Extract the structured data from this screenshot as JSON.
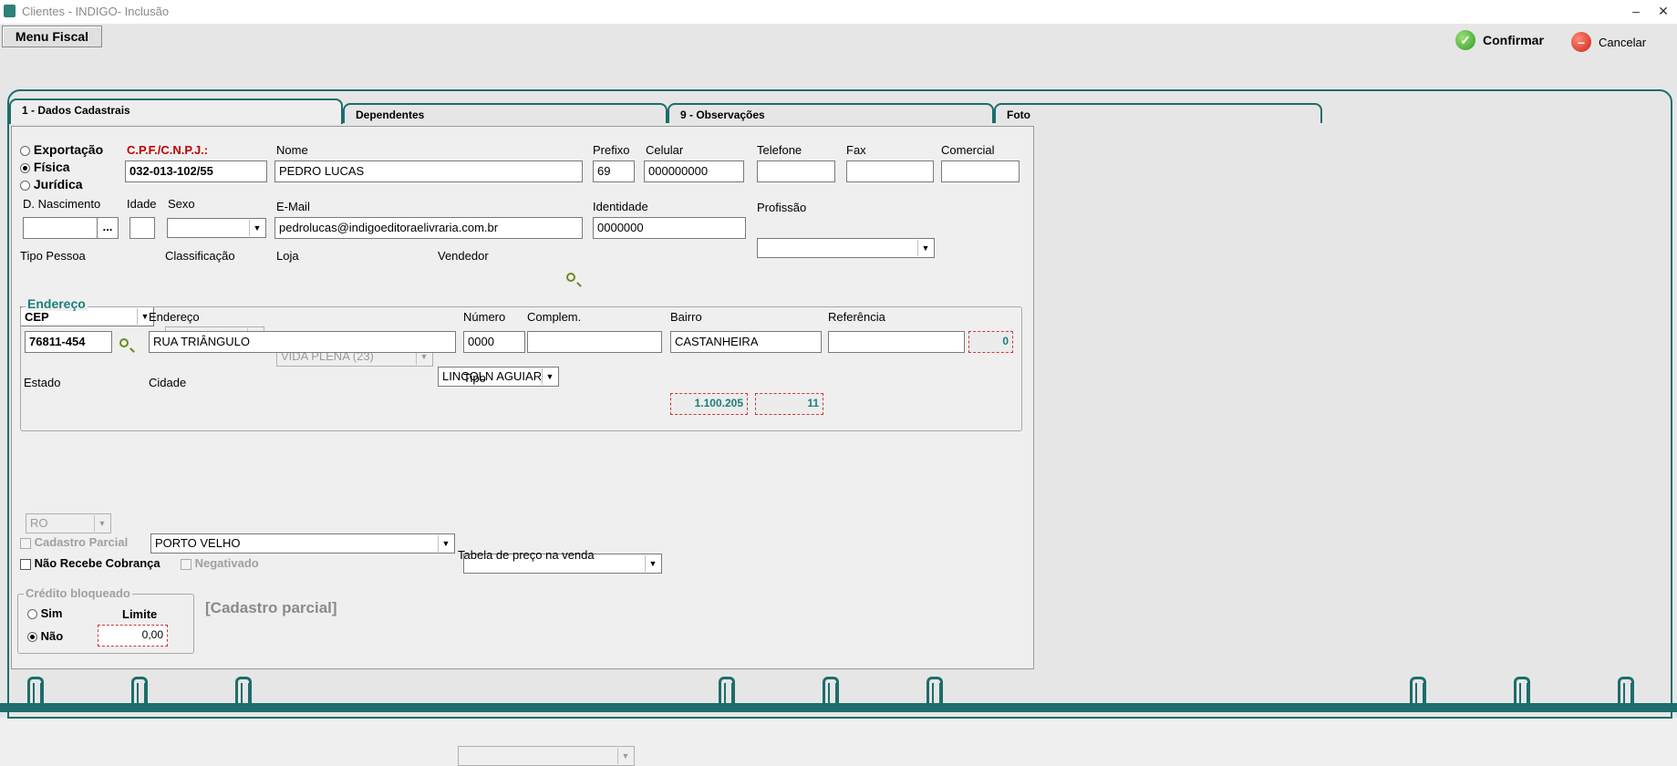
{
  "window": {
    "title": "Clientes - INDIGO- Inclusão",
    "minimize": "–",
    "close": "✕"
  },
  "toolbar": {
    "menu_fiscal": "Menu Fiscal",
    "confirmar": "Confirmar",
    "cancelar": "Cancelar"
  },
  "tabs": [
    {
      "label": "1 - Dados Cadastrais"
    },
    {
      "label": "Dependentes"
    },
    {
      "label": "9 - Observações"
    },
    {
      "label": "Foto"
    }
  ],
  "tipo_cliente": {
    "options": [
      "Exportação",
      "Física",
      "Jurídica"
    ],
    "selected": "Física"
  },
  "form": {
    "cpf_label": "C.P.F./C.N.P.J.:",
    "cpf": "032-013-102/55",
    "nome_label": "Nome",
    "nome": "PEDRO LUCAS",
    "prefixo_label": "Prefixo",
    "prefixo": "69",
    "celular_label": "Celular",
    "celular": "000000000",
    "telefone_label": "Telefone",
    "telefone": "",
    "fax_label": "Fax",
    "fax": "",
    "comercial_label": "Comercial",
    "comercial": "",
    "nascimento_label": "D. Nascimento",
    "nascimento": "",
    "nascimento_btn": "...",
    "idade_label": "Idade",
    "idade": "",
    "sexo_label": "Sexo",
    "sexo": "",
    "email_label": "E-Mail",
    "email": "pedrolucas@indigoeditoraelivraria.com.br",
    "identidade_label": "Identidade",
    "identidade": "0000000",
    "profissao_label": "Profissão",
    "profissao": "",
    "tipo_pessoa_label": "Tipo Pessoa",
    "tipo_pessoa": "",
    "classificacao_label": "Classificação",
    "classificacao": "",
    "loja_label": "Loja",
    "loja": "VIDA PLENA (23)",
    "vendedor_label": "Vendedor",
    "vendedor": "LINCOLN AGUIAR"
  },
  "endereco": {
    "title": "Endereço",
    "cep_label": "CEP",
    "cep": "76811-454",
    "endereco_label": "Endereço",
    "endereco": "RUA TRIÂNGULO",
    "numero_label": "Número",
    "numero": "0000",
    "complem_label": "Complem.",
    "complem": "",
    "bairro_label": "Bairro",
    "bairro": "CASTANHEIRA",
    "referencia_label": "Referência",
    "referencia": "",
    "ref_code": "0",
    "estado_label": "Estado",
    "estado": "RO",
    "cidade_label": "Cidade",
    "cidade": "PORTO VELHO",
    "tipo_label": "Tipo",
    "tipo": "",
    "codigo_cidade": "1.100.205",
    "codigo_uf": "11"
  },
  "flags": {
    "cadastro_parcial": "Cadastro Parcial",
    "nao_recebe_cobranca": "Não Recebe Cobrança",
    "negativado": "Negativado"
  },
  "tabela_preco": {
    "label": "Tabela de preço na venda",
    "value": ""
  },
  "credito": {
    "title": "Crédito bloqueado",
    "sim": "Sim",
    "nao": "Não",
    "selected": "Não",
    "limite_label": "Limite",
    "limite": "0,00"
  },
  "status_text": "[Cadastro parcial]",
  "colors": {
    "teal": "#1c6d6b",
    "required_red": "#c00000",
    "code_teal": "#1a7f7a"
  }
}
